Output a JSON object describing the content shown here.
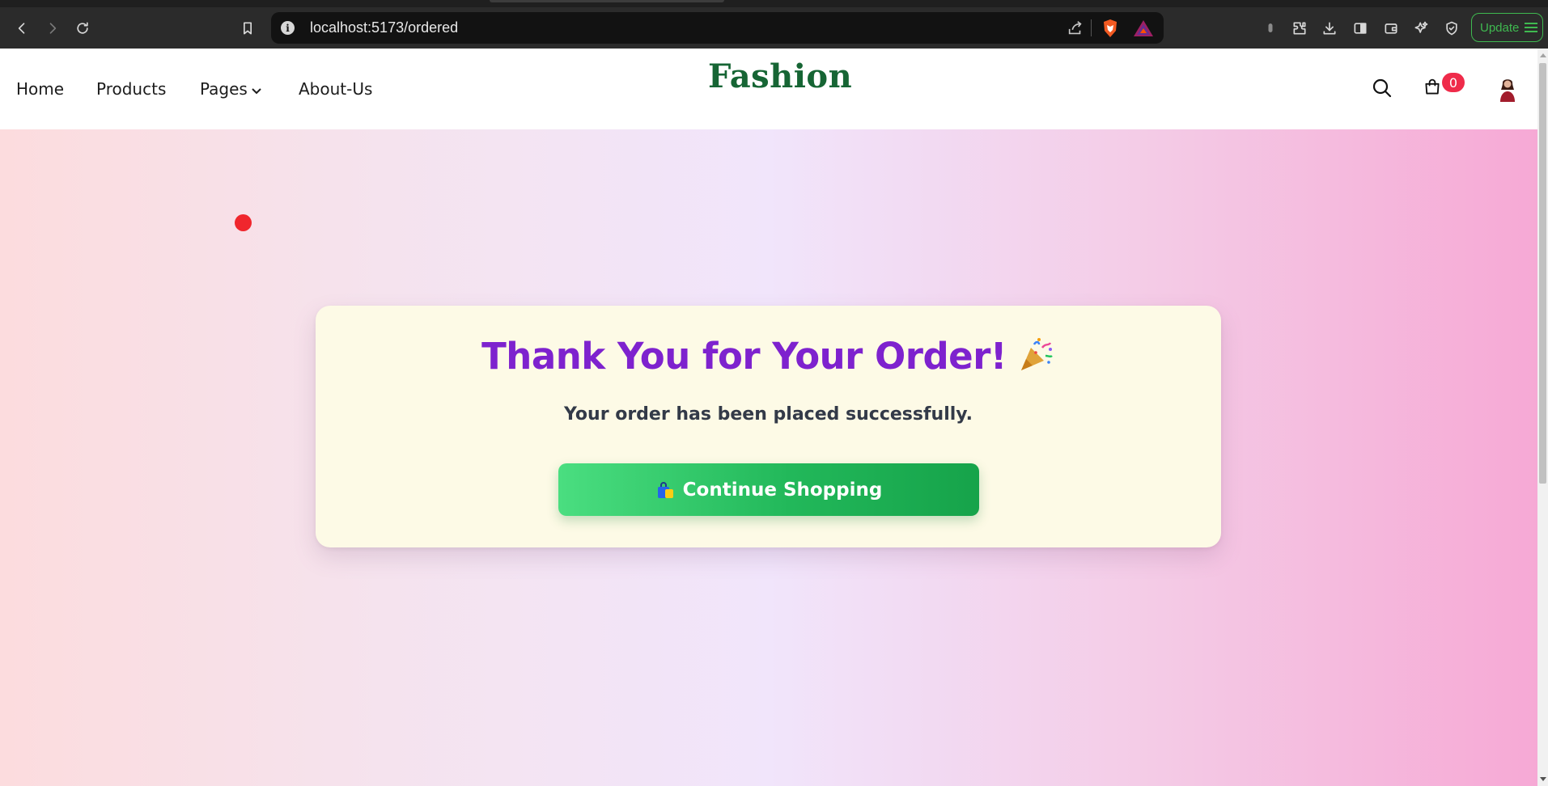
{
  "browser": {
    "url": "localhost:5173/ordered",
    "update_label": "Update"
  },
  "nav": {
    "links": [
      {
        "label": "Home"
      },
      {
        "label": "Products"
      },
      {
        "label": "Pages"
      },
      {
        "label": "About-Us"
      }
    ],
    "logo": "Fashion",
    "cart_count": "0"
  },
  "order": {
    "title": "Thank You for Your Order!",
    "subtitle": "Your order has been placed successfully.",
    "button_label": "Continue Shopping"
  },
  "colors": {
    "logo": "#166534",
    "title": "#7e22ce",
    "button": "#22b85a",
    "badge": "#ef2b4a",
    "card": "#fdfae6"
  },
  "icons": [
    "back-icon",
    "forward-icon",
    "reload-icon",
    "bookmark-icon",
    "info-icon",
    "share-icon",
    "brave-shield-icon",
    "bat-rewards-icon",
    "extensions-icon",
    "download-icon",
    "sidebar-icon",
    "wallet-icon",
    "leo-ai-icon",
    "vpn-icon",
    "search-icon",
    "shopping-bag-icon",
    "party-popper-icon",
    "bag-emoji-icon"
  ]
}
